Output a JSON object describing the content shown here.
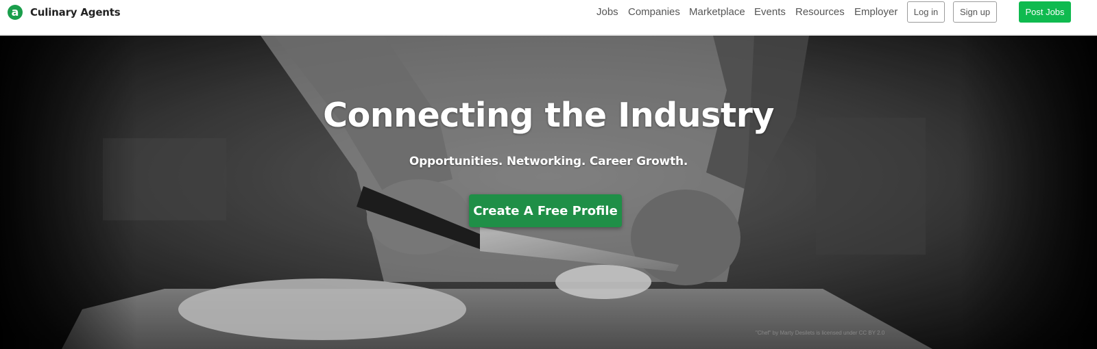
{
  "header": {
    "brand": "Culinary Agents",
    "logo_letter": "a",
    "nav": [
      "Jobs",
      "Companies",
      "Marketplace",
      "Events",
      "Resources",
      "Employer"
    ],
    "login_label": "Log in",
    "signup_label": "Sign up",
    "post_jobs_label": "Post Jobs"
  },
  "hero": {
    "title": "Connecting the Industry",
    "subtitle": "Opportunities. Networking. Career Growth.",
    "cta_label": "Create A Free Profile",
    "photo_credit": "\"Chef\" by Marty Desilets is licensed under CC BY 2.0"
  },
  "colors": {
    "brand_green": "#1a9e4b",
    "post_jobs_green": "#0fba4f",
    "cta_green": "#1f8f47"
  }
}
